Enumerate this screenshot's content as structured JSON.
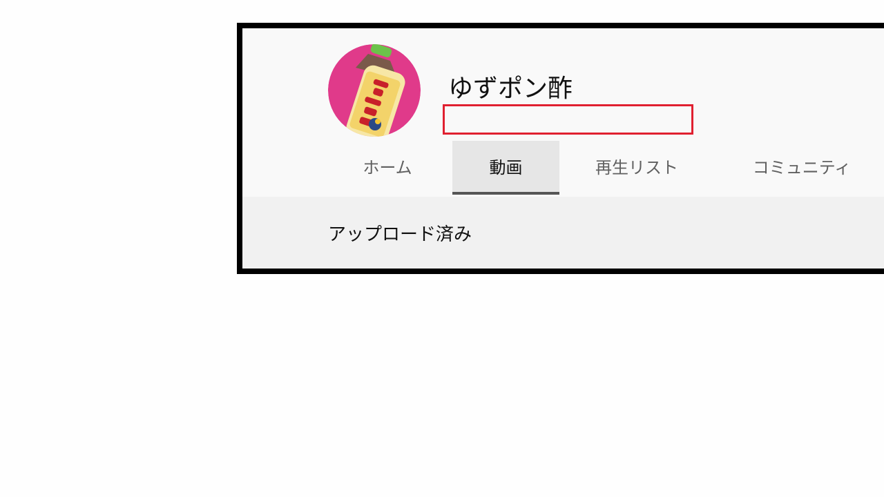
{
  "channel": {
    "name": "ゆずポン酢",
    "avatar_icon": "yuzu-ponzu-bottle-icon",
    "avatar_label": "ゆずポン酢",
    "colors": {
      "avatar_bg": "#e03a8a",
      "bottle_label": "#f3d36a",
      "label_text": "#c8202a"
    }
  },
  "annotation": {
    "highlight_color": "#e02030"
  },
  "tabs": [
    {
      "label": "ホーム",
      "active": false
    },
    {
      "label": "動画",
      "active": true
    },
    {
      "label": "再生リスト",
      "active": false
    },
    {
      "label": "コミュニティ",
      "active": false
    }
  ],
  "content": {
    "section_label": "アップロード済み"
  }
}
